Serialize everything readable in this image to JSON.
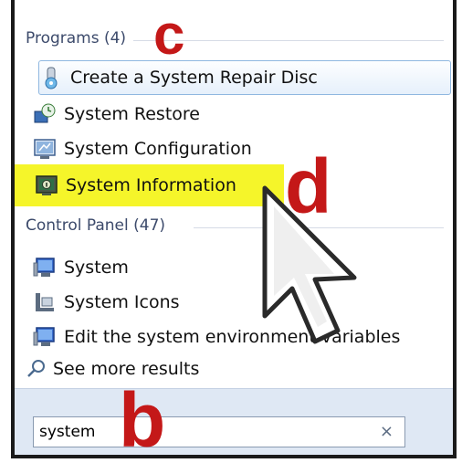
{
  "programs": {
    "header": "Programs (4)",
    "items": [
      {
        "label": "Create a System Repair Disc",
        "icon": "repair-disc-icon"
      },
      {
        "label": "System Restore",
        "icon": "system-restore-icon"
      },
      {
        "label": "System Configuration",
        "icon": "system-configuration-icon"
      },
      {
        "label": "System Information",
        "icon": "system-information-icon"
      }
    ]
  },
  "control_panel": {
    "header": "Control Panel (47)",
    "items": [
      {
        "label": "System",
        "icon": "system-icon"
      },
      {
        "label": "System Icons",
        "icon": "system-icons-icon"
      },
      {
        "label": "Edit the system environment variables",
        "icon": "environment-variables-icon"
      }
    ]
  },
  "see_more": {
    "label": "See more results",
    "icon": "search-icon"
  },
  "search": {
    "value": "system",
    "clear_symbol": "×"
  },
  "annotations": {
    "b": "b",
    "c": "c",
    "d": "d"
  },
  "colors": {
    "highlight": "#f5f52a",
    "annotation": "#c41818",
    "footer": "#dfe8f4"
  }
}
